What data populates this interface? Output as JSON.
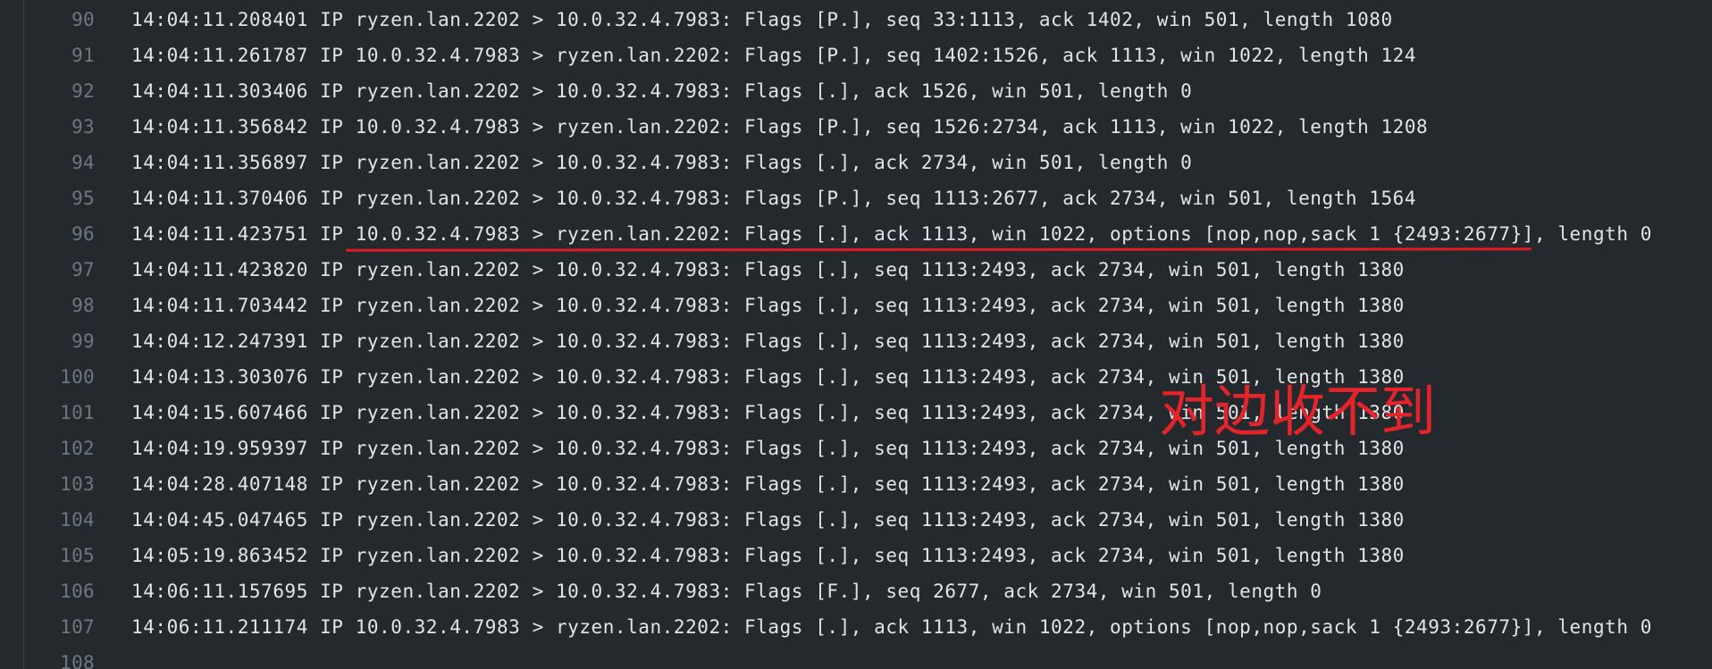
{
  "log": {
    "lines": [
      {
        "num": "90",
        "text": "14:04:11.208401 IP ryzen.lan.2202 > 10.0.32.4.7983: Flags [P.], seq 33:1113, ack 1402, win 501, length 1080"
      },
      {
        "num": "91",
        "text": "14:04:11.261787 IP 10.0.32.4.7983 > ryzen.lan.2202: Flags [P.], seq 1402:1526, ack 1113, win 1022, length 124"
      },
      {
        "num": "92",
        "text": "14:04:11.303406 IP ryzen.lan.2202 > 10.0.32.4.7983: Flags [.], ack 1526, win 501, length 0"
      },
      {
        "num": "93",
        "text": "14:04:11.356842 IP 10.0.32.4.7983 > ryzen.lan.2202: Flags [P.], seq 1526:2734, ack 1113, win 1022, length 1208"
      },
      {
        "num": "94",
        "text": "14:04:11.356897 IP ryzen.lan.2202 > 10.0.32.4.7983: Flags [.], ack 2734, win 501, length 0"
      },
      {
        "num": "95",
        "text": "14:04:11.370406 IP ryzen.lan.2202 > 10.0.32.4.7983: Flags [P.], seq 1113:2677, ack 2734, win 501, length 1564"
      },
      {
        "num": "96",
        "text": "14:04:11.423751 IP 10.0.32.4.7983 > ryzen.lan.2202: Flags [.], ack 1113, win 1022, options [nop,nop,sack 1 {2493:2677}], length 0"
      },
      {
        "num": "97",
        "text": "14:04:11.423820 IP ryzen.lan.2202 > 10.0.32.4.7983: Flags [.], seq 1113:2493, ack 2734, win 501, length 1380"
      },
      {
        "num": "98",
        "text": "14:04:11.703442 IP ryzen.lan.2202 > 10.0.32.4.7983: Flags [.], seq 1113:2493, ack 2734, win 501, length 1380"
      },
      {
        "num": "99",
        "text": "14:04:12.247391 IP ryzen.lan.2202 > 10.0.32.4.7983: Flags [.], seq 1113:2493, ack 2734, win 501, length 1380"
      },
      {
        "num": "100",
        "text": "14:04:13.303076 IP ryzen.lan.2202 > 10.0.32.4.7983: Flags [.], seq 1113:2493, ack 2734, win 501, length 1380"
      },
      {
        "num": "101",
        "text": "14:04:15.607466 IP ryzen.lan.2202 > 10.0.32.4.7983: Flags [.], seq 1113:2493, ack 2734, win 501, length 1380"
      },
      {
        "num": "102",
        "text": "14:04:19.959397 IP ryzen.lan.2202 > 10.0.32.4.7983: Flags [.], seq 1113:2493, ack 2734, win 501, length 1380"
      },
      {
        "num": "103",
        "text": "14:04:28.407148 IP ryzen.lan.2202 > 10.0.32.4.7983: Flags [.], seq 1113:2493, ack 2734, win 501, length 1380"
      },
      {
        "num": "104",
        "text": "14:04:45.047465 IP ryzen.lan.2202 > 10.0.32.4.7983: Flags [.], seq 1113:2493, ack 2734, win 501, length 1380"
      },
      {
        "num": "105",
        "text": "14:05:19.863452 IP ryzen.lan.2202 > 10.0.32.4.7983: Flags [.], seq 1113:2493, ack 2734, win 501, length 1380"
      },
      {
        "num": "106",
        "text": "14:06:11.157695 IP ryzen.lan.2202 > 10.0.32.4.7983: Flags [F.], seq 2677, ack 2734, win 501, length 0"
      },
      {
        "num": "107",
        "text": "14:06:11.211174 IP 10.0.32.4.7983 > ryzen.lan.2202: Flags [.], ack 1113, win 1022, options [nop,nop,sack 1 {2493:2677}], length 0"
      },
      {
        "num": "108",
        "text": ""
      }
    ]
  },
  "annotation": {
    "text": "对边收不到",
    "color": "#e3242b"
  },
  "colors": {
    "background": "#24292e",
    "text": "#e1e4e8",
    "line_number": "#6e7681",
    "underline": "#e01b24"
  }
}
